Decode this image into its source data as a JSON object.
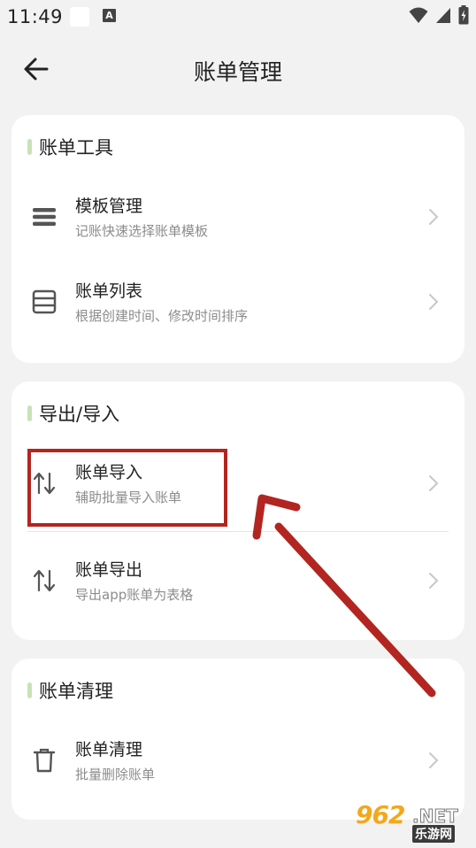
{
  "status_bar": {
    "time": "11:49",
    "a_badge": "A",
    "icons": [
      "wifi-icon",
      "signal-icon",
      "battery-icon"
    ]
  },
  "header": {
    "title": "账单管理",
    "back_icon": "back-arrow-icon"
  },
  "sections": [
    {
      "title": "账单工具",
      "items": [
        {
          "title": "模板管理",
          "subtitle": "记账快速选择账单模板",
          "icon": "menu-lines-icon"
        },
        {
          "title": "账单列表",
          "subtitle": "根据创建时间、修改时间排序",
          "icon": "list-box-icon"
        }
      ]
    },
    {
      "title": "导出/导入",
      "items": [
        {
          "title": "账单导入",
          "subtitle": "辅助批量导入账单",
          "icon": "swap-vertical-icon"
        },
        {
          "title": "账单导出",
          "subtitle": "导出app账单为表格",
          "icon": "swap-vertical-icon"
        }
      ]
    },
    {
      "title": "账单清理",
      "items": [
        {
          "title": "账单清理",
          "subtitle": "批量删除账单",
          "icon": "trash-icon"
        }
      ]
    }
  ],
  "watermark": {
    "number": "962",
    "domain": ".NET",
    "site": "乐游网"
  },
  "colors": {
    "accent_bar": "#c8e2b5",
    "annotation": "#b32520",
    "background": "#f2f2f2",
    "card": "#ffffff"
  }
}
